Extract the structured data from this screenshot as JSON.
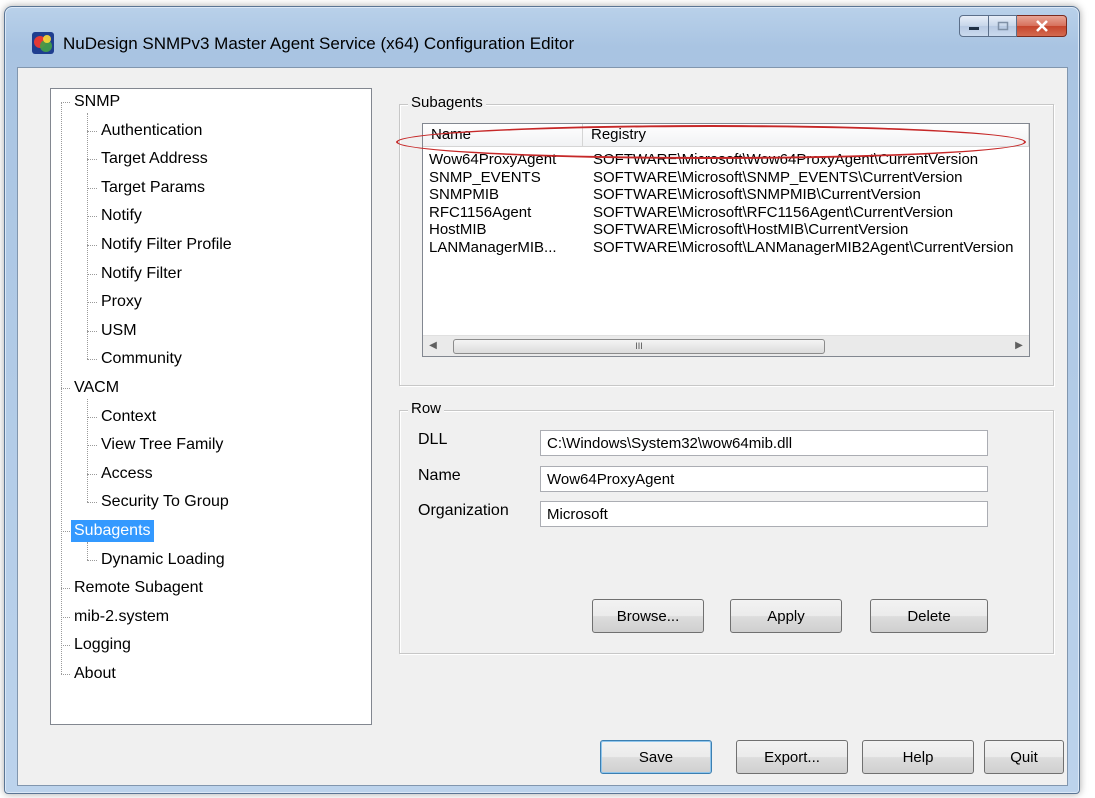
{
  "window": {
    "title": "NuDesign SNMPv3 Master Agent Service (x64) Configuration Editor",
    "icon": "nudesign-app-icon"
  },
  "tree": {
    "items": [
      {
        "label": "SNMP",
        "level": 0
      },
      {
        "label": "Authentication",
        "level": 1
      },
      {
        "label": "Target Address",
        "level": 1
      },
      {
        "label": "Target Params",
        "level": 1
      },
      {
        "label": "Notify",
        "level": 1
      },
      {
        "label": "Notify Filter Profile",
        "level": 1
      },
      {
        "label": "Notify Filter",
        "level": 1
      },
      {
        "label": "Proxy",
        "level": 1
      },
      {
        "label": "USM",
        "level": 1
      },
      {
        "label": "Community",
        "level": 1
      },
      {
        "label": "VACM",
        "level": 0
      },
      {
        "label": "Context",
        "level": 1
      },
      {
        "label": "View Tree Family",
        "level": 1
      },
      {
        "label": "Access",
        "level": 1
      },
      {
        "label": "Security To Group",
        "level": 1
      },
      {
        "label": "Subagents",
        "level": 0,
        "selected": true
      },
      {
        "label": "Dynamic Loading",
        "level": 1
      },
      {
        "label": "Remote Subagent",
        "level": 0
      },
      {
        "label": "mib-2.system",
        "level": 0
      },
      {
        "label": "Logging",
        "level": 0
      },
      {
        "label": "About",
        "level": 0
      }
    ]
  },
  "subagents": {
    "group_title": "Subagents",
    "columns": [
      "Name",
      "Registry"
    ],
    "rows": [
      {
        "name": "Wow64ProxyAgent",
        "registry": "SOFTWARE\\Microsoft\\Wow64ProxyAgent\\CurrentVersion"
      },
      {
        "name": "SNMP_EVENTS",
        "registry": "SOFTWARE\\Microsoft\\SNMP_EVENTS\\CurrentVersion"
      },
      {
        "name": "SNMPMIB",
        "registry": "SOFTWARE\\Microsoft\\SNMPMIB\\CurrentVersion"
      },
      {
        "name": "RFC1156Agent",
        "registry": "SOFTWARE\\Microsoft\\RFC1156Agent\\CurrentVersion"
      },
      {
        "name": "HostMIB",
        "registry": "SOFTWARE\\Microsoft\\HostMIB\\CurrentVersion"
      },
      {
        "name": "LANManagerMIB...",
        "registry": "SOFTWARE\\Microsoft\\LANManagerMIB2Agent\\CurrentVersion"
      }
    ],
    "scroll_thumb_grip": "III"
  },
  "row": {
    "group_title": "Row",
    "dll_label": "DLL",
    "dll_value": "C:\\Windows\\System32\\wow64mib.dll",
    "name_label": "Name",
    "name_value": "Wow64ProxyAgent",
    "org_label": "Organization",
    "org_value": "Microsoft",
    "browse_label": "Browse...",
    "apply_label": "Apply",
    "delete_label": "Delete"
  },
  "bottom": {
    "save_label": "Save",
    "export_label": "Export...",
    "help_label": "Help",
    "quit_label": "Quit"
  },
  "colors": {
    "selection": "#3399ff",
    "annotation": "#c62828"
  }
}
